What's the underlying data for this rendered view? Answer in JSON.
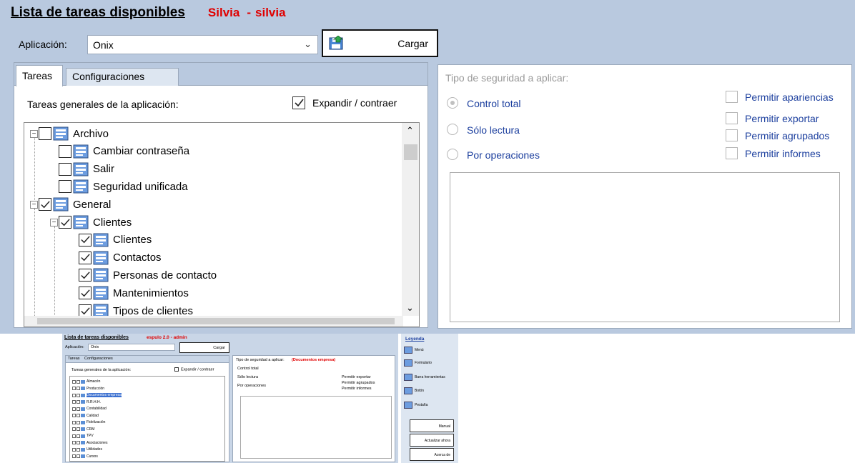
{
  "header": {
    "title": "Lista de tareas disponibles",
    "user_name": "Silvia",
    "separator": "-",
    "user_login": "silvia"
  },
  "app_selector": {
    "label": "Aplicación:",
    "value": "Onix",
    "load_button": "Cargar"
  },
  "tabs": [
    "Tareas",
    "Configuraciones"
  ],
  "tasks_panel": {
    "label": "Tareas generales de la aplicación:",
    "expand_label": "Expandir / contraer",
    "expand_checked": true
  },
  "tree": [
    {
      "label": "Archivo",
      "level": 0,
      "expander": "−",
      "checked": false
    },
    {
      "label": "Cambiar contraseña",
      "level": 1,
      "checked": false
    },
    {
      "label": "Salir",
      "level": 1,
      "checked": false
    },
    {
      "label": "Seguridad unificada",
      "level": 1,
      "checked": false
    },
    {
      "label": "General",
      "level": 0,
      "expander": "−",
      "checked": true
    },
    {
      "label": "Clientes",
      "level": 1,
      "expander": "−",
      "checked": true
    },
    {
      "label": "Clientes",
      "level": 2,
      "checked": true
    },
    {
      "label": "Contactos",
      "level": 2,
      "checked": true
    },
    {
      "label": "Personas de contacto",
      "level": 2,
      "checked": true
    },
    {
      "label": "Mantenimientos",
      "level": 2,
      "checked": true
    },
    {
      "label": "Tipos de clientes",
      "level": 2,
      "checked": true
    }
  ],
  "security": {
    "label": "Tipo de seguridad a aplicar:",
    "options": [
      "Control total",
      "Sólo lectura",
      "Por operaciones"
    ],
    "selected": "Control total",
    "permissions": [
      "Permitir apariencias",
      "Permitir exportar",
      "Permitir agrupados",
      "Permitir informes"
    ]
  },
  "thumbnail": {
    "title": "Lista de tareas disponibles",
    "user": "espulo 2.0  -  admin",
    "app_label": "Aplicación:",
    "app_value": "Onix",
    "load_button": "Cargar",
    "tabs": [
      "Tareas",
      "Configuraciones"
    ],
    "tasks_label": "Tareas generales de la aplicación:",
    "expand_label": "Expandir / contraer",
    "tree": [
      "Almacén",
      "Producción",
      "Documentos empresa",
      "R.R.H.H.",
      "Contabilidad",
      "Calidad",
      "Fidelización",
      "CRM",
      "TPV",
      "Asociaciones",
      "Utilidades",
      "Cursos"
    ],
    "highlighted": "Documentos empresa",
    "security_label": "Tipo de seguridad a aplicar:",
    "context": "(Documentos empresa)",
    "options": [
      "Control total",
      "Sólo lectura",
      "Por operaciones"
    ],
    "permissions": [
      "Permitir exportar",
      "Permitir agrupados",
      "Permitir informes"
    ],
    "legend_title": "Leyenda",
    "legend": [
      "Menú",
      "Formulario",
      "Barra herramientas",
      "Botón",
      "Pestaña"
    ],
    "buttons": [
      "Manual",
      "Actualizar ahora",
      "Acerca de"
    ]
  }
}
